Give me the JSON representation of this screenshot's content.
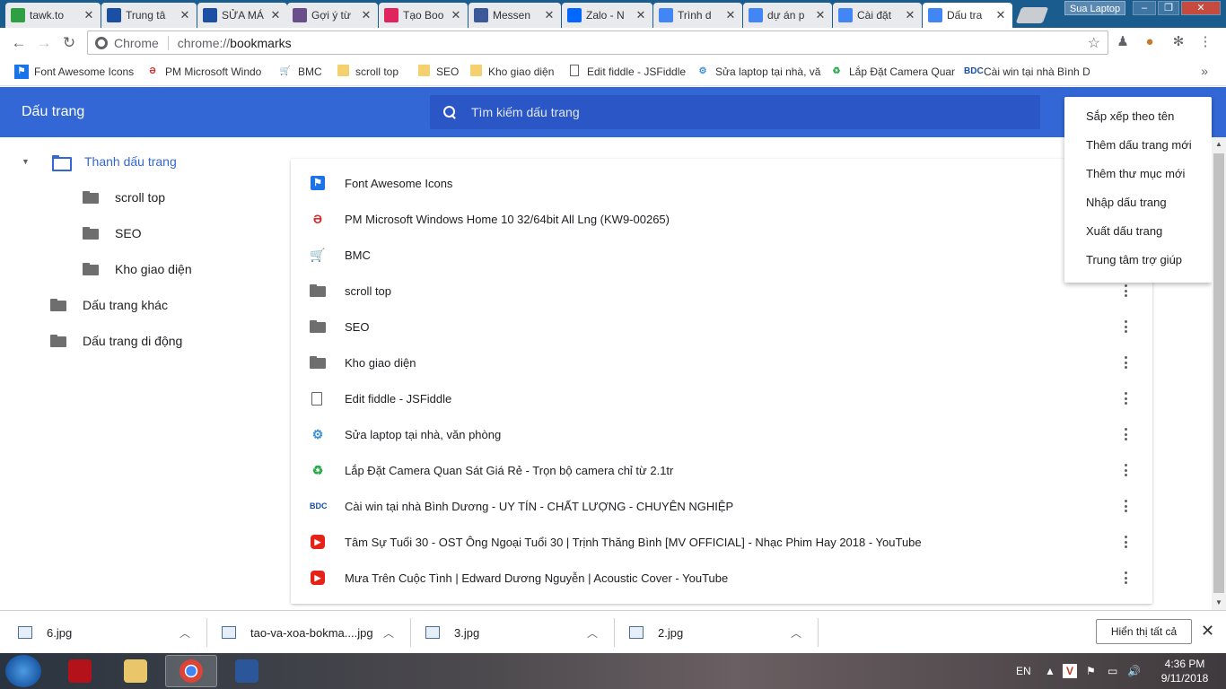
{
  "tabs": [
    {
      "title": "tawk.to",
      "icon": "tawk-icon",
      "color": "#2ea043"
    },
    {
      "title": "Trung tâ",
      "icon": "plus-cross-icon",
      "color": "#1a4fa3"
    },
    {
      "title": "SỬA MÁ",
      "icon": "bdc-icon",
      "color": "#1a4fa3"
    },
    {
      "title": "Gợi ý từ",
      "icon": "avatar-icon",
      "color": "#6a4e8a"
    },
    {
      "title": "Tạo Boo",
      "icon": "t-letter-icon",
      "color": "#e0245e"
    },
    {
      "title": "Messen",
      "icon": "facebook-icon",
      "color": "#3b5998"
    },
    {
      "title": "Zalo - N",
      "icon": "zalo-icon",
      "color": "#0068ff"
    },
    {
      "title": "Trình d",
      "icon": "chrome-icon",
      "color": "#4285f4"
    },
    {
      "title": "dự án p",
      "icon": "google-icon",
      "color": "#4285f4"
    },
    {
      "title": "Cài đặt",
      "icon": "gear-icon",
      "color": "#4285f4"
    },
    {
      "title": "Dấu tra",
      "icon": "star-icon",
      "color": "#4285f4"
    }
  ],
  "window": {
    "profile_name": "Sua Laptop"
  },
  "omnibox": {
    "label": "Chrome",
    "url_host": "chrome://",
    "url_path": "bookmarks"
  },
  "bookmark_bar": [
    {
      "label": "Font Awesome Icons",
      "icon": "flag-icon"
    },
    {
      "label": "PM Microsoft Windo",
      "icon": "phucanh-icon"
    },
    {
      "label": "BMC",
      "icon": "cart-icon"
    },
    {
      "label": "scroll top",
      "icon": "folder-icon"
    },
    {
      "label": "SEO",
      "icon": "folder-icon"
    },
    {
      "label": "Kho giao diện",
      "icon": "folder-icon"
    },
    {
      "label": "Edit fiddle - JSFiddle",
      "icon": "page-icon"
    },
    {
      "label": "Sửa laptop tại nhà, vă",
      "icon": "gear-icon"
    },
    {
      "label": "Lắp Đặt Camera Quan",
      "icon": "recycle-icon"
    },
    {
      "label": "Cài win tại nhà Bình D",
      "icon": "bdc-icon"
    }
  ],
  "header": {
    "title": "Dấu trang",
    "search_placeholder": "Tìm kiếm dấu trang"
  },
  "sidebar": {
    "root": "Thanh dấu trang",
    "children": [
      "scroll top",
      "SEO",
      "Kho giao diện"
    ],
    "others": [
      "Dấu trang khác",
      "Dấu trang di động"
    ]
  },
  "bookmarks": [
    {
      "title": "Font Awesome Icons",
      "icon": "flag-icon"
    },
    {
      "title": "PM Microsoft Windows Home 10 32/64bit All Lng (KW9-00265)",
      "icon": "phucanh-icon"
    },
    {
      "title": "BMC",
      "icon": "cart-icon"
    },
    {
      "title": "scroll top",
      "icon": "folder-icon"
    },
    {
      "title": "SEO",
      "icon": "folder-icon"
    },
    {
      "title": "Kho giao diện",
      "icon": "folder-icon"
    },
    {
      "title": "Edit fiddle - JSFiddle",
      "icon": "page-icon"
    },
    {
      "title": "Sửa laptop tại nhà, văn phòng",
      "icon": "gear-icon"
    },
    {
      "title": "Lắp Đặt Camera Quan Sát Giá Rẻ - Trọn bộ camera chỉ từ 2.1tr",
      "icon": "recycle-icon"
    },
    {
      "title": "Cài win tại nhà Bình Dương - UY TÍN - CHẤT LƯỢNG - CHUYÊN NGHIỆP",
      "icon": "bdc-icon"
    },
    {
      "title": "Tâm Sự Tuổi 30 - OST Ông Ngoại Tuổi 30 | Trịnh Thăng Bình [MV OFFICIAL] - Nhạc Phim Hay 2018 - YouTube",
      "icon": "youtube-icon"
    },
    {
      "title": "Mưa Trên Cuộc Tình | Edward Dương Nguyễn | Acoustic Cover - YouTube",
      "icon": "youtube-icon"
    }
  ],
  "menu": [
    "Sắp xếp theo tên",
    "Thêm dấu trang mới",
    "Thêm thư mục mới",
    "Nhập dấu trang",
    "Xuất dấu trang",
    "Trung tâm trợ giúp"
  ],
  "downloads": {
    "items": [
      "6.jpg",
      "tao-va-xoa-bokma....jpg",
      "3.jpg",
      "2.jpg"
    ],
    "show_all": "Hiển thị tất cả"
  },
  "taskbar": {
    "language": "EN",
    "time": "4:36 PM",
    "date": "9/11/2018"
  },
  "colors": {
    "header": "#3367d6",
    "search": "#2a56c6",
    "accent": "#3367d6"
  }
}
